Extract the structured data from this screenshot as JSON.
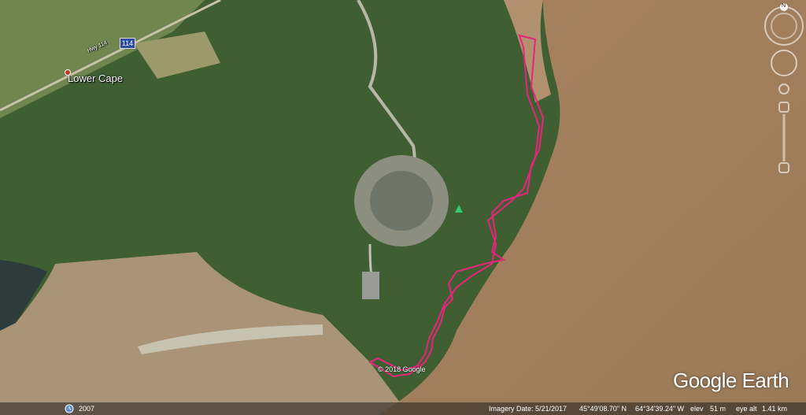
{
  "map": {
    "place_label": "Lower Cape",
    "road_shield": "114",
    "road_name": "Hwy 114",
    "copyright": "© 2018 Google",
    "brand": "Google Earth",
    "north_label": "N",
    "track_color": "#e8247c"
  },
  "status_bar": {
    "year": "2007",
    "imagery_date": "Imagery Date: 5/21/2017",
    "lat": "45°49'08.70\" N",
    "lon": "64°34'39.24\" W",
    "elev_label": "elev",
    "elev_value": "51 m",
    "eye_alt_label": "eye alt",
    "eye_alt_value": "1.41 km"
  }
}
